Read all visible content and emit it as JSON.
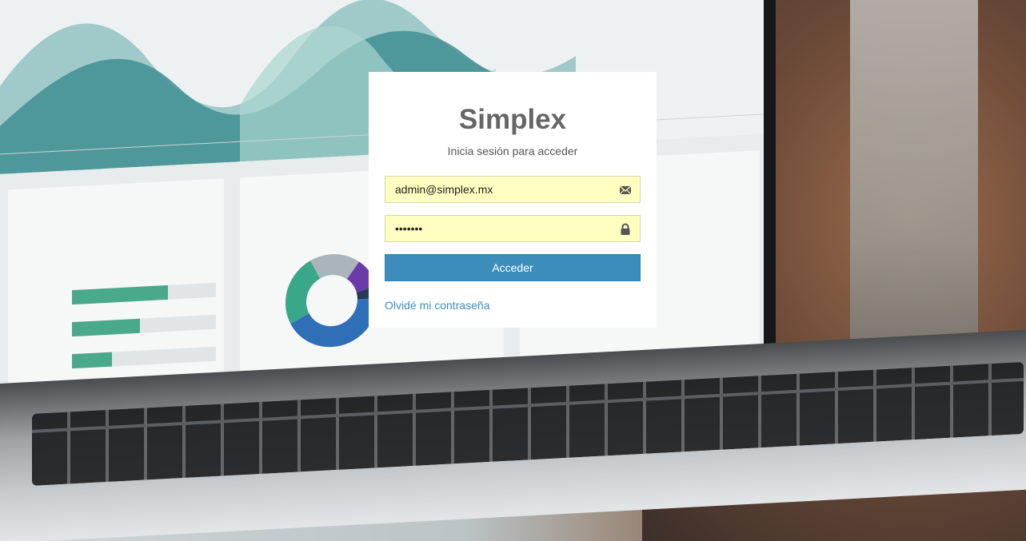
{
  "login": {
    "title": "Simplex",
    "subtitle": "Inicia sesión para acceder",
    "email_value": "admin@simplex.mx",
    "password_value": "•••••••",
    "submit_label": "Acceder",
    "forgot_link": "Olvidé mi contraseña"
  },
  "icons": {
    "email": "envelope-icon",
    "password": "lock-icon"
  },
  "colors": {
    "accent": "#3c8dbc",
    "input_bg": "#ffffc0",
    "title": "#666666"
  }
}
